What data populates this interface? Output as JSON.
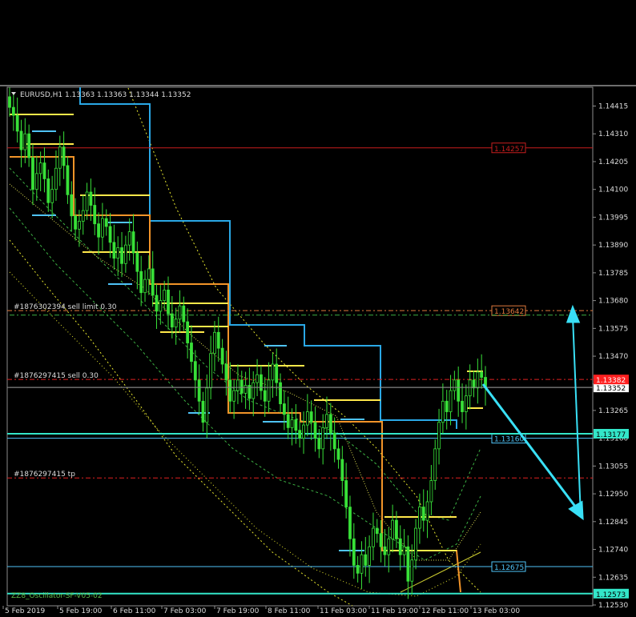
{
  "chart_data": {
    "type": "candlestick",
    "symbol_header": "EURUSD,H1  1.13363 1.13363 1.13344 1.13352",
    "ylim": [
      1.1253,
      1.1448
    ],
    "y_ticks": [
      1.14415,
      1.1431,
      1.14205,
      1.141,
      1.13995,
      1.1389,
      1.13785,
      1.1368,
      1.13575,
      1.1347,
      1.13365,
      1.13265,
      1.1316,
      1.13055,
      1.1295,
      1.12845,
      1.1274,
      1.12635,
      1.1253
    ],
    "y_tick_labels": [
      "1.14415",
      "1.14310",
      "1.14205",
      "1.14100",
      "1.13995",
      "1.13890",
      "1.13785",
      "1.13680",
      "1.13575",
      "1.13470",
      "1.13365",
      "1.13265",
      "1.13160",
      "1.13055",
      "1.12950",
      "1.12845",
      "1.12740",
      "1.12635",
      "1.12530"
    ],
    "x_tick_labels": [
      "5 Feb 2019",
      "5 Feb 19:00",
      "6 Feb 11:00",
      "7 Feb 03:00",
      "7 Feb 19:00",
      "8 Feb 11:00",
      "11 Feb 03:00",
      "11 Feb 19:00",
      "12 Feb 11:00",
      "13 Feb 03:00"
    ],
    "current_price": {
      "label": "1.13352",
      "value": 1.13352
    },
    "price_tags": [
      {
        "label": "1.13382",
        "value": 1.13382,
        "color": "#ff2020"
      },
      {
        "label": "1.13177",
        "value": 1.13177,
        "color": "#33e6c9"
      },
      {
        "label": "1.12573",
        "value": 1.12573,
        "color": "#33e6c9"
      }
    ],
    "levels": [
      {
        "name": "resistance-line",
        "value": 1.14257,
        "label": "1.14257",
        "color": "#c81e1e"
      },
      {
        "name": "sell-limit-line",
        "value": 1.13642,
        "label": "1.13642",
        "color": "#e07a3c",
        "note": "#1876302394 sell limit 0.30"
      },
      {
        "name": "sell-line",
        "value": 1.13382,
        "label": "",
        "color": "#e02020",
        "note": "#1876297415 sell 0.30"
      },
      {
        "name": "current-price-line",
        "value": 1.13352,
        "label": "",
        "color": "#8c8c8c",
        "note": ""
      },
      {
        "name": "support-line",
        "value": 1.1316,
        "label": "1.13160",
        "color": "#4fc3f7"
      },
      {
        "name": "tp-line",
        "value": 1.1301,
        "label": "",
        "color": "#e02020",
        "note": "#1876297415 tp"
      },
      {
        "name": "low-line",
        "value": 1.12675,
        "label": "1.12675",
        "color": "#4fc3f7"
      }
    ],
    "bottom_label": "ZZ8_Oscillator-SF-V05-02",
    "closes": [
      1.1441,
      1.1438,
      1.1432,
      1.1425,
      1.1431,
      1.1422,
      1.141,
      1.1416,
      1.142,
      1.1414,
      1.1405,
      1.141,
      1.1418,
      1.1426,
      1.1419,
      1.1408,
      1.14,
      1.1395,
      1.1398,
      1.1402,
      1.1409,
      1.1404,
      1.1397,
      1.1392,
      1.1399,
      1.1396,
      1.139,
      1.1384,
      1.1388,
      1.1382,
      1.1389,
      1.1394,
      1.1386,
      1.1379,
      1.1371,
      1.1376,
      1.138,
      1.137,
      1.1364,
      1.1368,
      1.1372,
      1.1363,
      1.1358,
      1.1361,
      1.1366,
      1.136,
      1.1352,
      1.1345,
      1.1338,
      1.133,
      1.1322,
      1.1335,
      1.1348,
      1.1356,
      1.135,
      1.1344,
      1.1338,
      1.133,
      1.1334,
      1.1338,
      1.1333,
      1.1336,
      1.1331,
      1.1337,
      1.134,
      1.1334,
      1.133,
      1.1338,
      1.1344,
      1.1337,
      1.1329,
      1.1325,
      1.132,
      1.1323,
      1.1319,
      1.1316,
      1.1321,
      1.1326,
      1.1322,
      1.1316,
      1.1312,
      1.132,
      1.1325,
      1.1318,
      1.1312,
      1.1308,
      1.13,
      1.129,
      1.1278,
      1.1268,
      1.1265,
      1.1272,
      1.1268,
      1.1275,
      1.1282,
      1.128,
      1.1275,
      1.1272,
      1.1278,
      1.1285,
      1.1278,
      1.1272,
      1.1275,
      1.1262,
      1.127,
      1.1282,
      1.129,
      1.1285,
      1.1292,
      1.13,
      1.1312,
      1.1322,
      1.133,
      1.1326,
      1.1334,
      1.1338,
      1.133,
      1.1326,
      1.1332,
      1.1338,
      1.1335,
      1.1341,
      1.1339,
      1.1335
    ]
  }
}
